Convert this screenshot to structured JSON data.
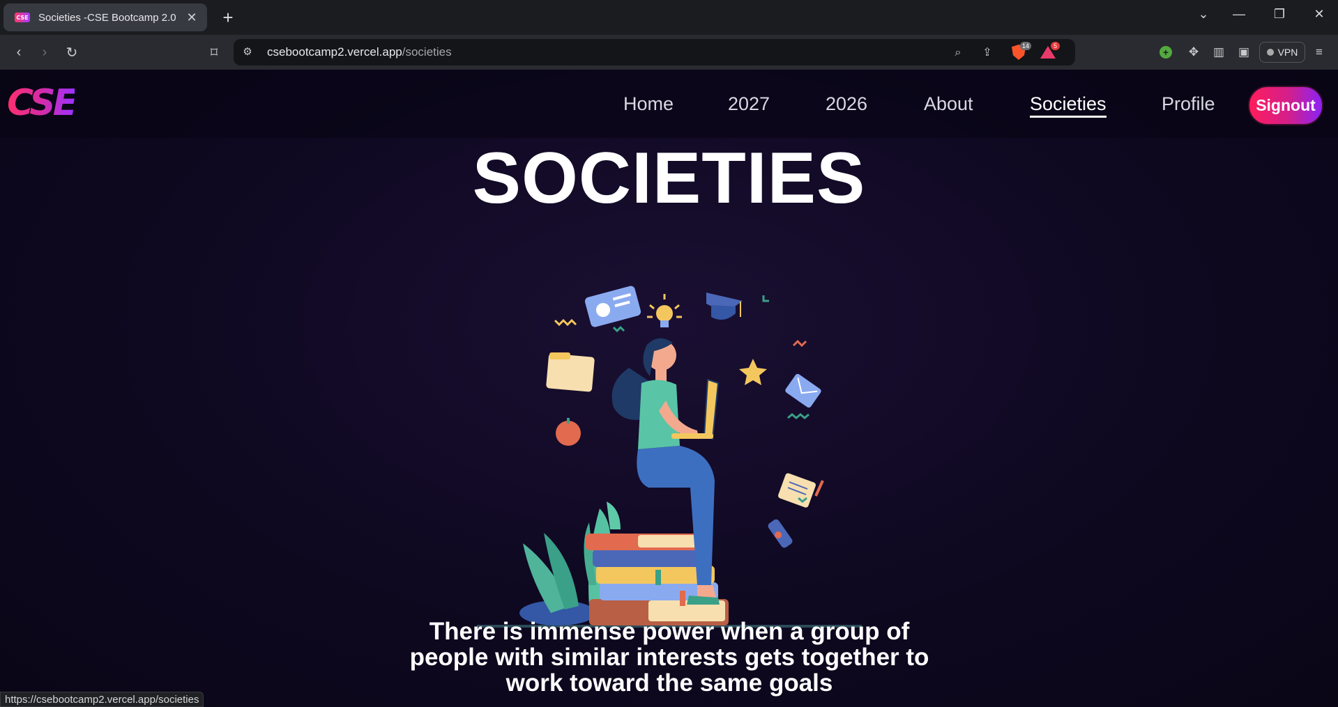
{
  "browser": {
    "tab_title": "Societies -CSE Bootcamp 2.0",
    "favicon_text": "CSE",
    "url_host": "csebootcamp2.vercel.app",
    "url_path": "/societies",
    "shield_count": "14",
    "rewards_count": "5",
    "vpn_label": "VPN",
    "status_url": "https://csebootcamp2.vercel.app/societies"
  },
  "site": {
    "logo_text": "CSE",
    "nav": [
      {
        "label": "Home"
      },
      {
        "label": "2027"
      },
      {
        "label": "2026"
      },
      {
        "label": "About"
      },
      {
        "label": "Societies",
        "active": true
      },
      {
        "label": "Profile"
      }
    ],
    "signout_label": "Signout"
  },
  "main": {
    "title": "SOCIETIES",
    "tagline": "There is immense power when a group of people with similar interests gets together to work toward the same goals"
  },
  "colors": {
    "background": "#0c0718",
    "accent_start": "#ff1d5c",
    "accent_end": "#8b23f5"
  }
}
